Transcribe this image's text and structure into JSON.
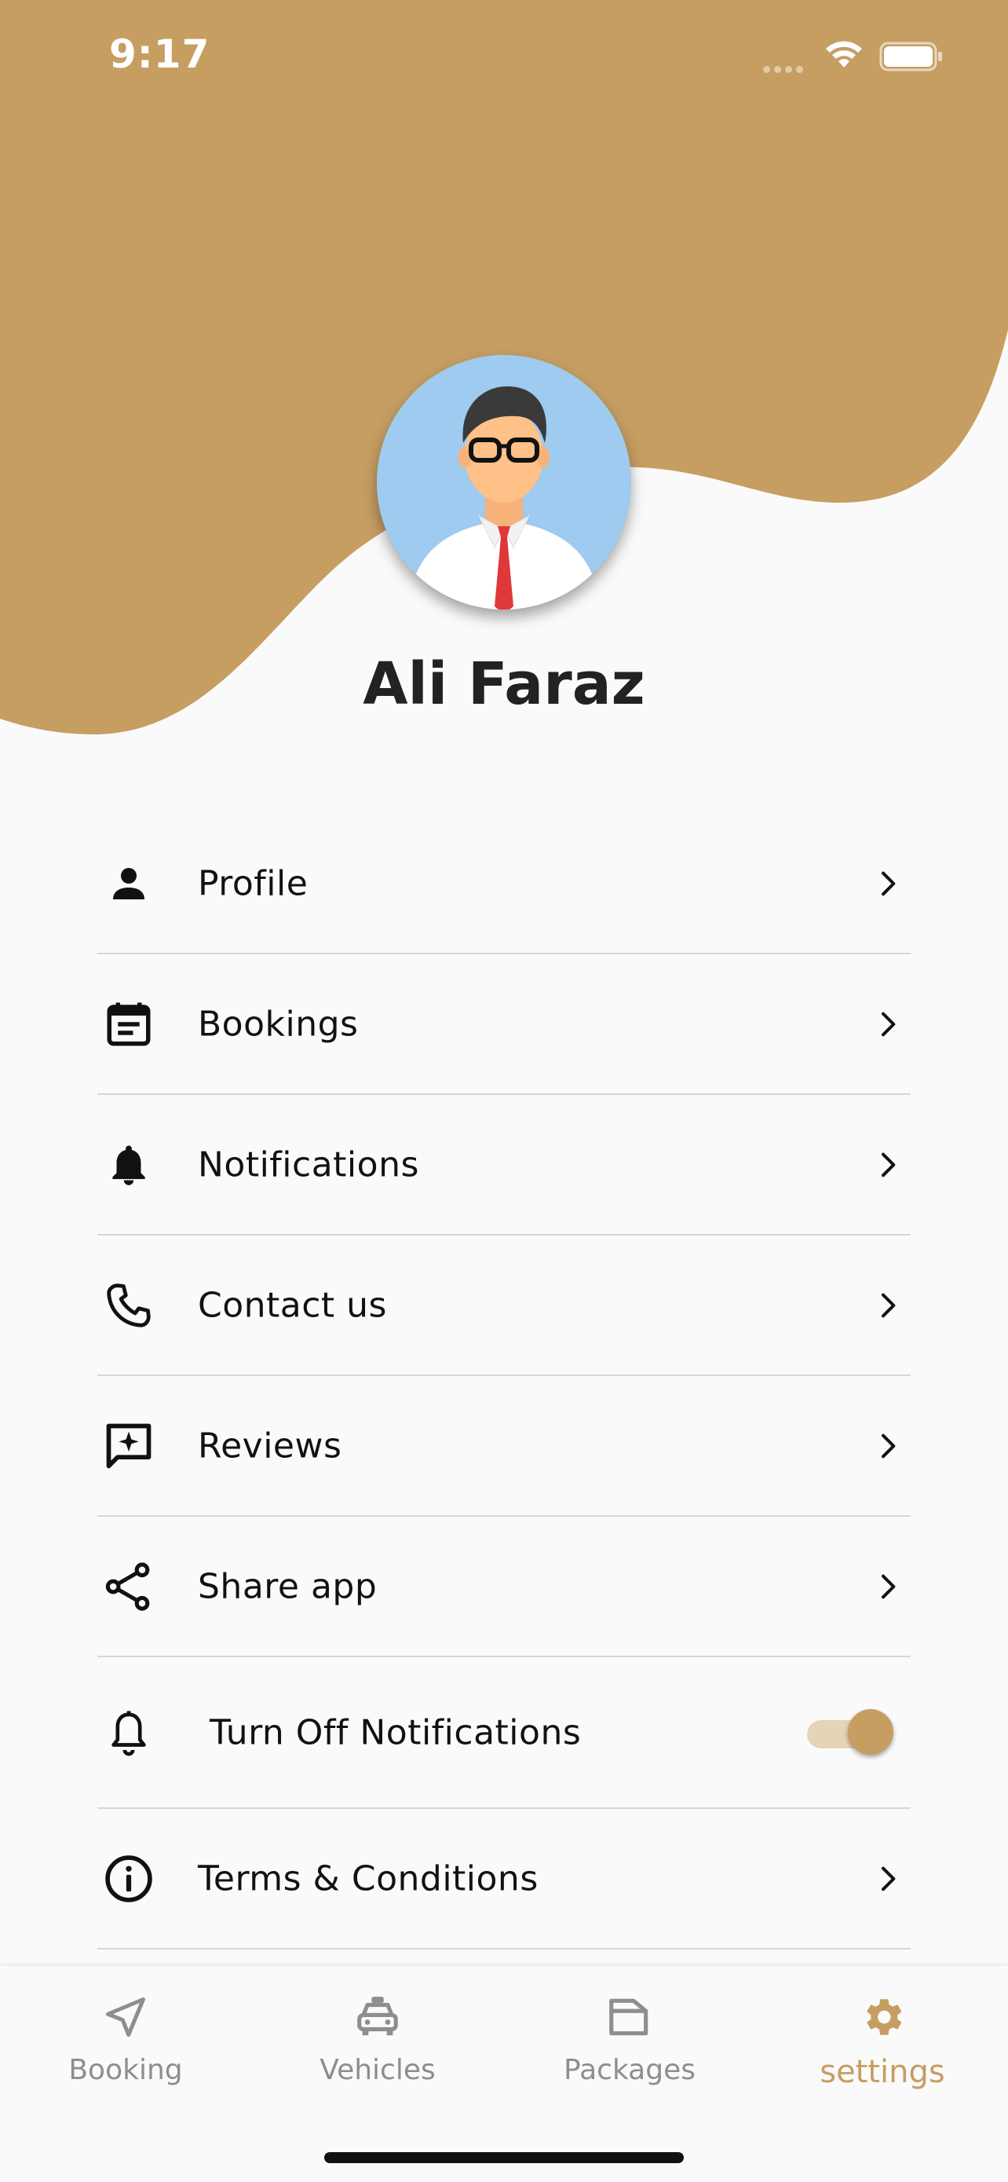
{
  "status_bar": {
    "time": "9:17",
    "signal_icon": "cellular-dots-icon",
    "wifi_icon": "wifi-icon",
    "battery_icon": "battery-icon"
  },
  "header": {
    "accent_color": "#c69e62",
    "avatar_icon": "user-avatar-illustration",
    "user_name": "Ali Faraz"
  },
  "menu": {
    "items": [
      {
        "label": "Profile",
        "icon": "person-icon"
      },
      {
        "label": "Bookings",
        "icon": "calendar-icon"
      },
      {
        "label": "Notifications",
        "icon": "bell-icon"
      },
      {
        "label": "Contact us",
        "icon": "phone-icon"
      },
      {
        "label": "Reviews",
        "icon": "review-icon"
      },
      {
        "label": "Share app",
        "icon": "share-icon"
      },
      {
        "label": "Turn Off Notifications",
        "icon": "bell-outline-icon",
        "toggle_on": true
      },
      {
        "label": "Terms & Conditions",
        "icon": "info-icon"
      }
    ]
  },
  "bottom_nav": {
    "tabs": [
      {
        "label": "Booking",
        "icon": "navigation-arrow-icon",
        "active": false
      },
      {
        "label": "Vehicles",
        "icon": "taxi-icon",
        "active": false
      },
      {
        "label": "Packages",
        "icon": "folder-icon",
        "active": false
      },
      {
        "label": "settings",
        "icon": "gear-icon",
        "active": true
      }
    ],
    "active_color": "#c69e62",
    "inactive_color": "#8e8e8e"
  }
}
